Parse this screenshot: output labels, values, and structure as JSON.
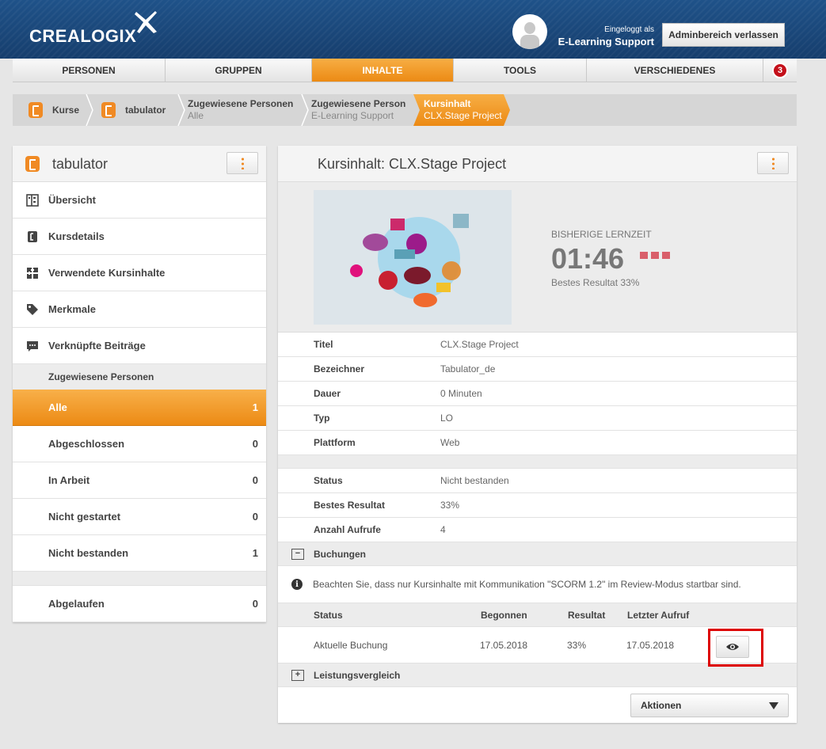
{
  "header": {
    "logo": "CREALOGIX",
    "login_label": "Eingeloggt als",
    "login_user": "E-Learning Support",
    "admin_button": "Adminbereich verlassen"
  },
  "nav": {
    "tabs": [
      {
        "label": "PERSONEN"
      },
      {
        "label": "GRUPPEN"
      },
      {
        "label": "INHALTE",
        "active": true
      },
      {
        "label": "TOOLS"
      },
      {
        "label": "VERSCHIEDENES"
      }
    ],
    "badge": "3"
  },
  "breadcrumb": {
    "items": [
      {
        "title": "Kurse"
      },
      {
        "title": "tabulator"
      },
      {
        "title": "Zugewiesene Personen",
        "subtitle": "Alle"
      },
      {
        "title": "Zugewiesene Person",
        "subtitle": "E-Learning Support"
      },
      {
        "title": "Kursinhalt",
        "subtitle": "CLX.Stage Project",
        "active": true
      }
    ]
  },
  "left": {
    "title": "tabulator",
    "menu": [
      {
        "label": "Übersicht",
        "icon": "overview-icon"
      },
      {
        "label": "Kursdetails",
        "icon": "course-icon"
      },
      {
        "label": "Verwendete Kursinhalte",
        "icon": "content-icon"
      },
      {
        "label": "Merkmale",
        "icon": "tag-icon"
      },
      {
        "label": "Verknüpfte Beiträge",
        "icon": "comment-icon"
      }
    ],
    "section": "Zugewiesene Personen",
    "filters": [
      {
        "label": "Alle",
        "count": "1",
        "active": true
      },
      {
        "label": "Abgeschlossen",
        "count": "0"
      },
      {
        "label": "In Arbeit",
        "count": "0"
      },
      {
        "label": "Nicht gestartet",
        "count": "0"
      },
      {
        "label": "Nicht bestanden",
        "count": "1"
      }
    ],
    "expired": {
      "label": "Abgelaufen",
      "count": "0"
    }
  },
  "right": {
    "title": "Kursinhalt: CLX.Stage Project",
    "learning_time_label": "BISHERIGE LERNZEIT",
    "learning_time": "01:46",
    "best_result_text": "Bestes Resultat 33%",
    "details": [
      {
        "key": "Titel",
        "value": "CLX.Stage Project"
      },
      {
        "key": "Bezeichner",
        "value": "Tabulator_de"
      },
      {
        "key": "Dauer",
        "value": "0 Minuten"
      },
      {
        "key": "Typ",
        "value": "LO"
      },
      {
        "key": "Plattform",
        "value": "Web"
      }
    ],
    "status": [
      {
        "key": "Status",
        "value": "Nicht bestanden"
      },
      {
        "key": "Bestes Resultat",
        "value": "33%"
      },
      {
        "key": "Anzahl Aufrufe",
        "value": "4"
      }
    ],
    "bookings_label": "Buchungen",
    "bookings_info": "Beachten Sie, dass nur Kursinhalte mit Kommunikation \"SCORM 1.2\" im Review-Modus startbar sind.",
    "bookings_columns": [
      "Status",
      "Begonnen",
      "Resultat",
      "Letzter Aufruf"
    ],
    "bookings_rows": [
      {
        "status": "Aktuelle Buchung",
        "started": "17.05.2018",
        "result": "33%",
        "last": "17.05.2018"
      }
    ],
    "comparison_label": "Leistungsvergleich",
    "actions_label": "Aktionen"
  }
}
